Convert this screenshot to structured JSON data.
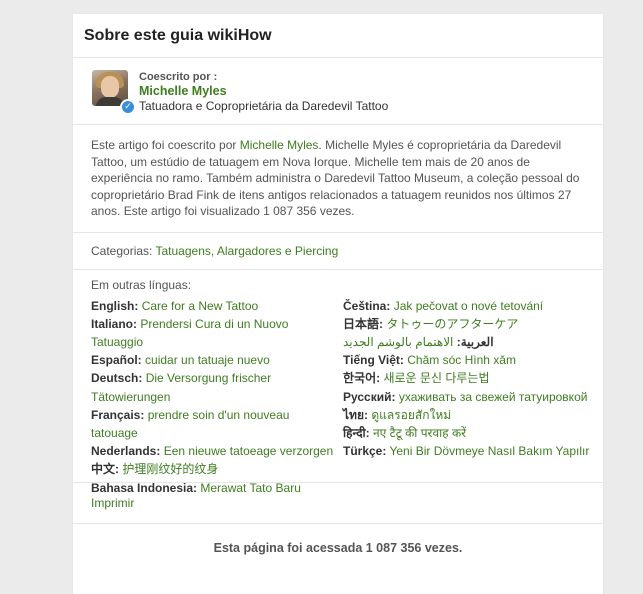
{
  "section_title": "Sobre este guia wikiHow",
  "author": {
    "label": "Coescrito por :",
    "name": "Michelle Myles",
    "role": "Tatuadora e Coproprietária da Daredevil Tattoo"
  },
  "bio": {
    "p1": "Este artigo foi coescrito por ",
    "name_link": "Michelle Myles",
    "p2": ". Michelle Myles é coproprietária da Daredevil Tattoo, um estúdio de tatuagem em Nova Iorque. Michelle tem mais de 20 anos de experiência no ramo. Também administra o Daredevil Tattoo Museum, a coleção pessoal do coproprietário Brad Fink de itens antigos relacionados a tatuagem reunidos nos últimos 27 anos. Este artigo foi visualizado 1 087 356 vezes."
  },
  "categories": {
    "label": "Categorias: ",
    "value": "Tatuagens, Alargadores e Piercing"
  },
  "other_languages": {
    "title": "Em outras línguas:",
    "left": [
      {
        "lang": "English:",
        "link": "Care for a New Tattoo"
      },
      {
        "lang": "Italiano:",
        "link": "Prendersi Cura di un Nuovo Tatuaggio"
      },
      {
        "lang": "Español:",
        "link": "cuidar un tatuaje nuevo"
      },
      {
        "lang": "Deutsch:",
        "link": "Die Versorgung frischer Tätowierungen"
      },
      {
        "lang": "Français:",
        "link": "prendre soin d'un nouveau tatouage"
      },
      {
        "lang": "Nederlands:",
        "link": "Een nieuwe tatoeage verzorgen"
      },
      {
        "lang": "中文:",
        "link": "护理刚纹好的纹身"
      },
      {
        "lang": "Bahasa Indonesia:",
        "link": "Merawat Tato Baru"
      }
    ],
    "right": [
      {
        "lang": "Čeština:",
        "link": "Jak pečovat o nové tetování"
      },
      {
        "lang": "日本語:",
        "link": "タトゥーのアフターケア"
      },
      {
        "lang": "العربية:",
        "link": "الاهتمام بالوشم الجديد"
      },
      {
        "lang": "Tiếng Việt:",
        "link": "Chăm sóc Hình xăm"
      },
      {
        "lang": "한국어:",
        "link": "새로운 문신 다루는법"
      },
      {
        "lang": "Русский:",
        "link": "ухаживать за свежей татуировкой"
      },
      {
        "lang": "ไทย:",
        "link": "ดูแลรอยสักใหม่"
      },
      {
        "lang": "हिन्दी:",
        "link": "नए टैटू की परवाह करें"
      },
      {
        "lang": "Türkçe:",
        "link": "Yeni Bir Dövmeye Nasıl Bakım Yapılır"
      }
    ]
  },
  "print_label": "Imprimir",
  "footer_text": "Esta página foi acessada 1 087 356 vezes."
}
